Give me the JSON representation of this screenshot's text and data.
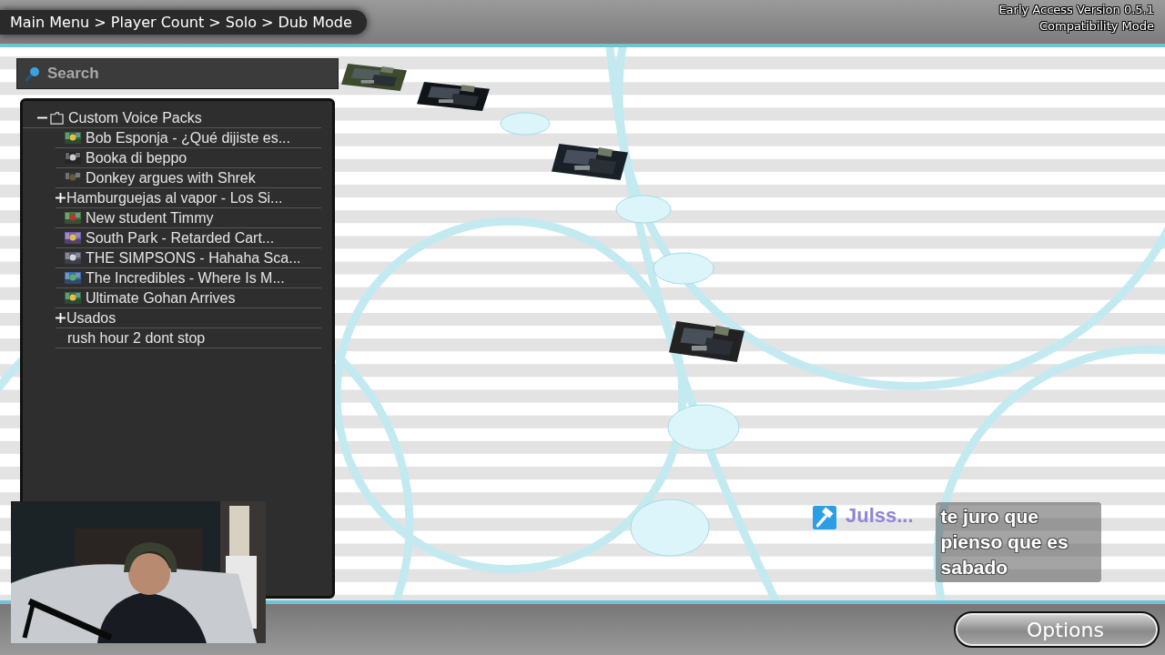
{
  "breadcrumb": "Main Menu > Player Count > Solo > Dub Mode",
  "version": [
    "Early Access Version 0.5.1",
    "Compatibility Mode"
  ],
  "search": {
    "placeholder": "Search"
  },
  "tree": [
    {
      "label": "Custom Voice Packs",
      "kind": "folder",
      "expanded": true,
      "children": [
        {
          "label": "Bob Esponja - ¿Qué dijiste es...",
          "kind": "pack"
        },
        {
          "label": "Booka di beppo",
          "kind": "pack"
        },
        {
          "label": "Donkey argues with Shrek",
          "kind": "pack"
        },
        {
          "label": "Hamburguejas al vapor - Los Si...",
          "kind": "folder",
          "expanded": false
        },
        {
          "label": "New student Timmy",
          "kind": "pack"
        },
        {
          "label": "South Park -  Retarded Cart...",
          "kind": "pack"
        },
        {
          "label": "THE SIMPSONS - Hahaha Sca...",
          "kind": "pack"
        },
        {
          "label": "The Incredibles - Where Is M...",
          "kind": "pack"
        },
        {
          "label": "Ultimate Gohan Arrives",
          "kind": "pack"
        },
        {
          "label": "Usados",
          "kind": "folder",
          "expanded": false
        },
        {
          "label": "rush hour 2 dont stop",
          "kind": "plain"
        }
      ]
    }
  ],
  "chat": {
    "user": "Julss...",
    "message": "te juro que pienso que es sabado"
  },
  "options_button": "Options"
}
